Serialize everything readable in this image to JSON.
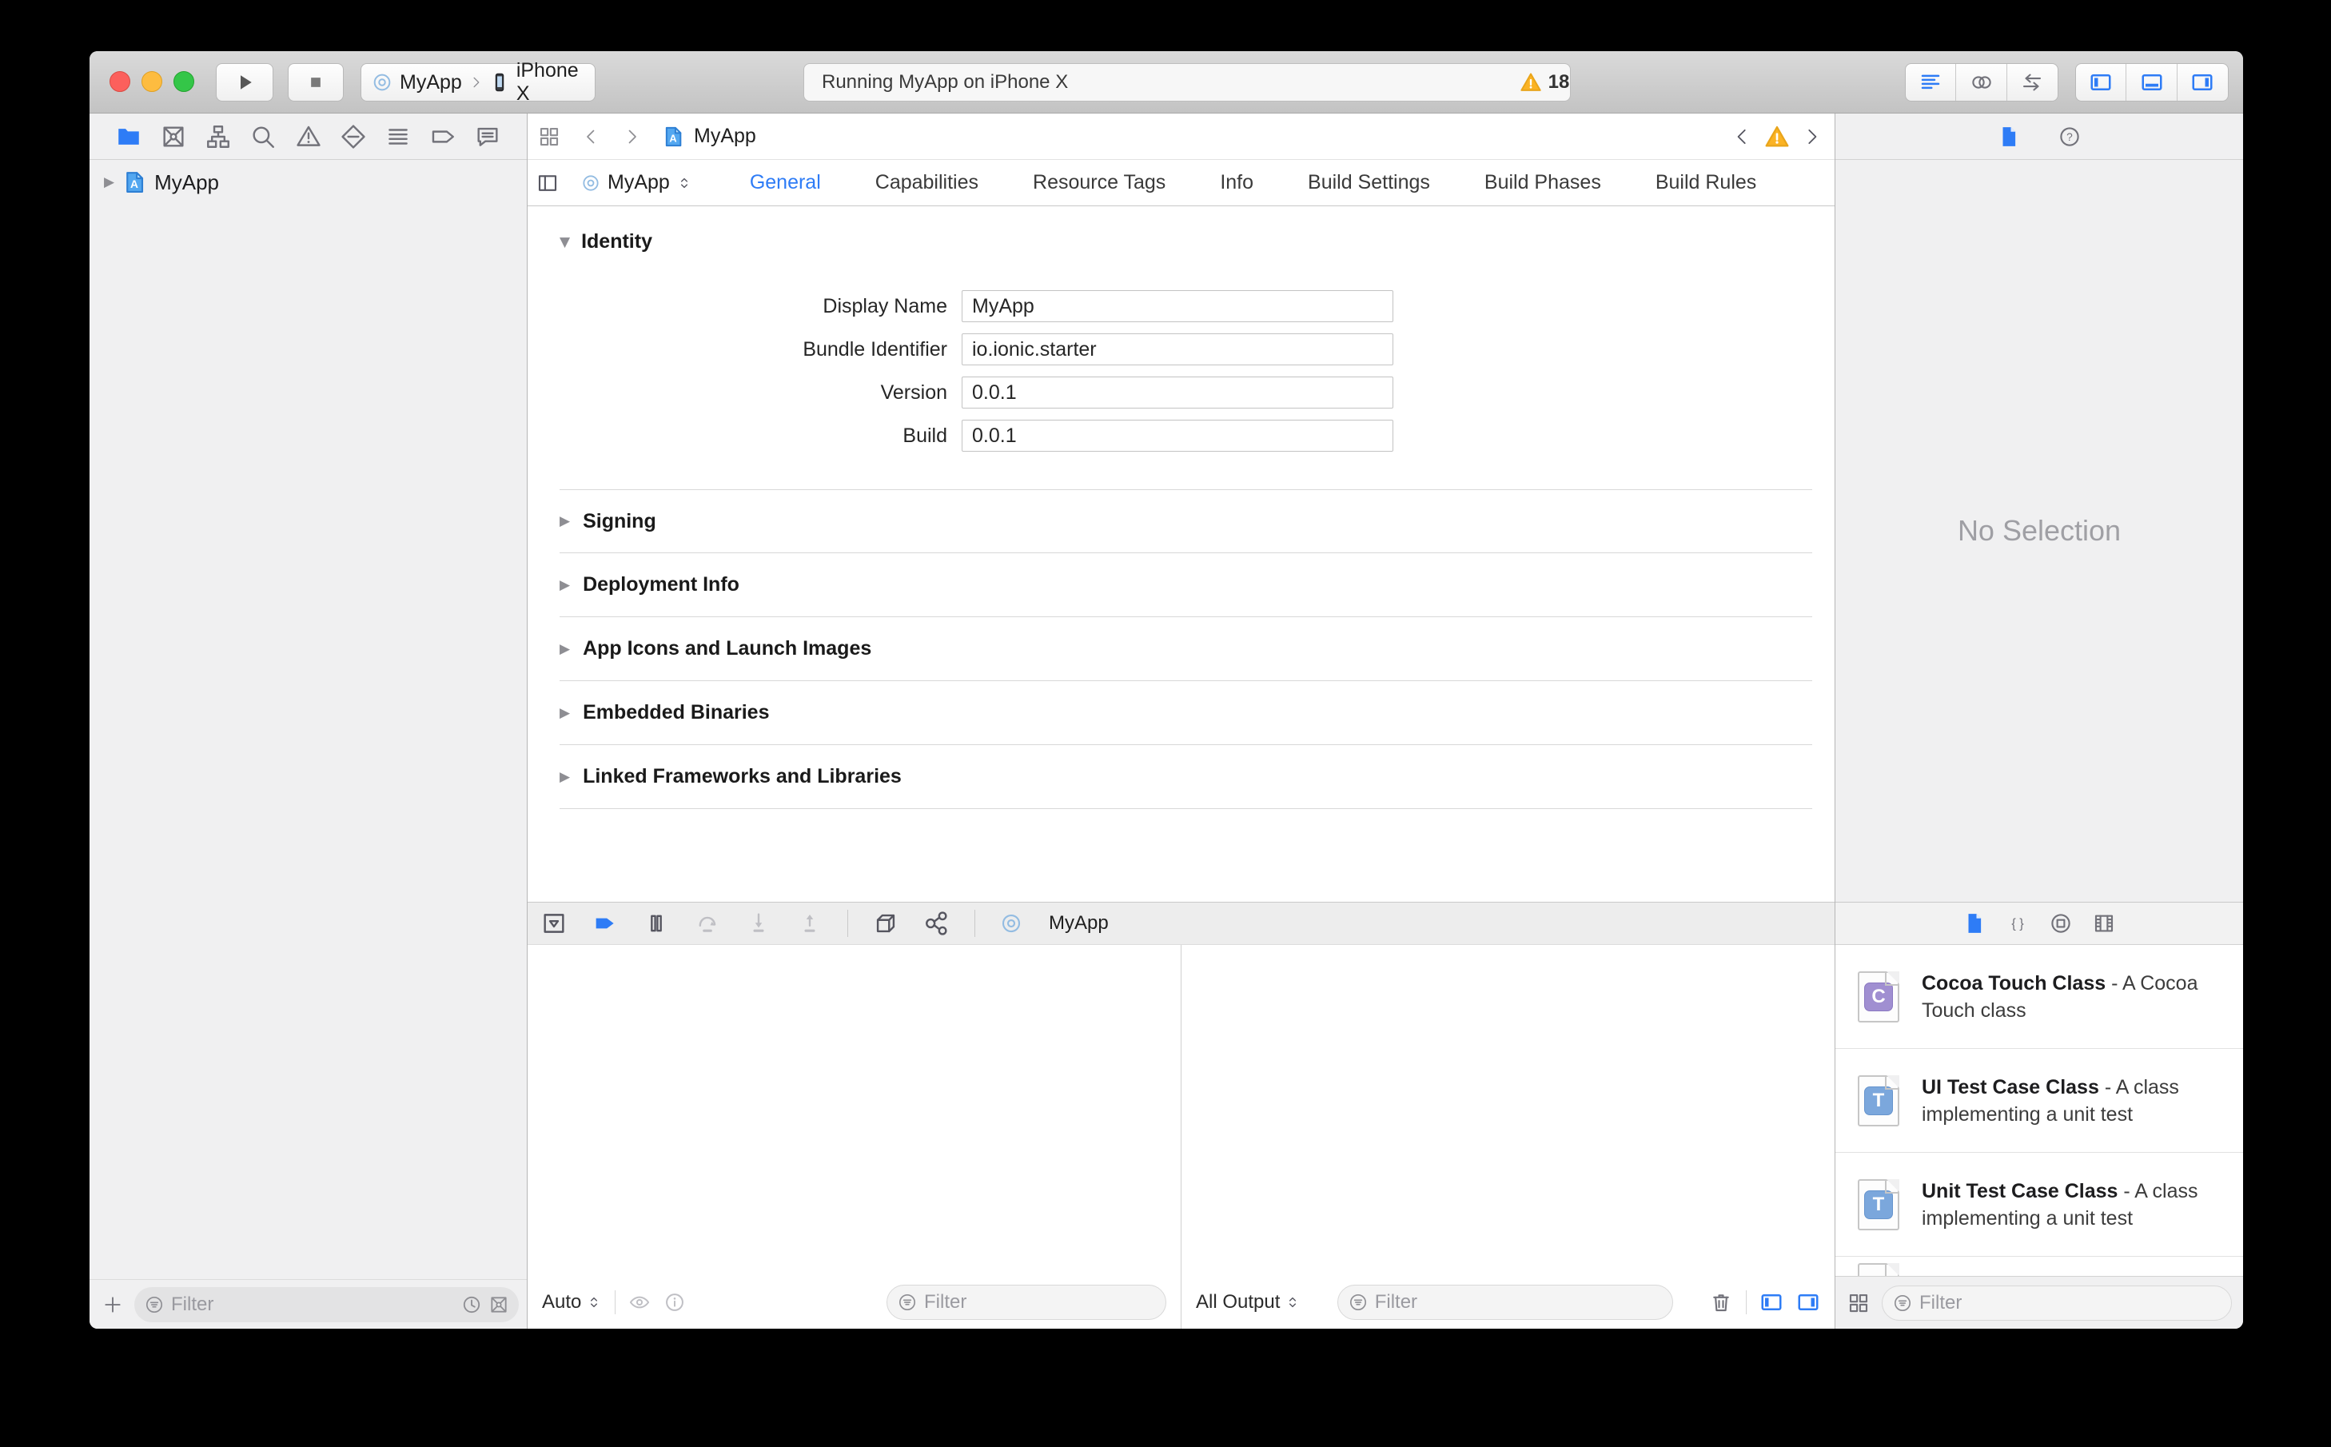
{
  "toolbar": {
    "scheme_project": "MyApp",
    "scheme_device": "iPhone X",
    "status_text": "Running MyApp on iPhone X",
    "warning_count": "18"
  },
  "navigator": {
    "project_name": "MyApp",
    "filter_placeholder": "Filter"
  },
  "editor": {
    "jumpbar_item": "MyApp",
    "target_name": "MyApp",
    "tabs": [
      "General",
      "Capabilities",
      "Resource Tags",
      "Info",
      "Build Settings",
      "Build Phases",
      "Build Rules"
    ],
    "selected_tab": "General",
    "identity": {
      "title": "Identity",
      "fields": [
        {
          "label": "Display Name",
          "value": "MyApp"
        },
        {
          "label": "Bundle Identifier",
          "value": "io.ionic.starter"
        },
        {
          "label": "Version",
          "value": "0.0.1"
        },
        {
          "label": "Build",
          "value": "0.0.1"
        }
      ]
    },
    "sections": [
      "Signing",
      "Deployment Info",
      "App Icons and Launch Images",
      "Embedded Binaries",
      "Linked Frameworks and Libraries"
    ]
  },
  "debug": {
    "target_name": "MyApp",
    "variables_scope": "Auto",
    "console_scope": "All Output",
    "variables_filter_placeholder": "Filter",
    "console_filter_placeholder": "Filter"
  },
  "inspector": {
    "no_selection": "No Selection",
    "filter_placeholder": "Filter",
    "library_items": [
      {
        "badge": "C",
        "badge_color": "#a08fd1",
        "title": "Cocoa Touch Class",
        "desc": " - A Cocoa Touch class"
      },
      {
        "badge": "T",
        "badge_color": "#7ba7dc",
        "title": "UI Test Case Class",
        "desc": " - A class implementing a unit test"
      },
      {
        "badge": "T",
        "badge_color": "#7ba7dc",
        "title": "Unit Test Case Class",
        "desc": " - A class implementing a unit test"
      }
    ]
  },
  "colors": {
    "accent": "#2e7cf6",
    "warning": "#fbb324"
  }
}
